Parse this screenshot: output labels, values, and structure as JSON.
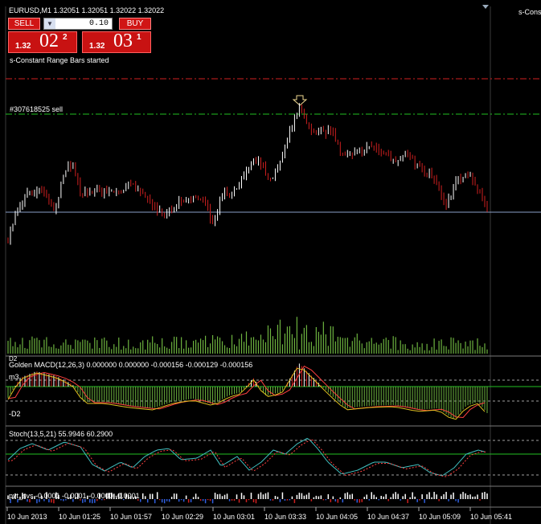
{
  "header": {
    "symbol_line": "EURUSD,M1  1.32051 1.32051 1.32022 1.32022",
    "right_label": "s-Cons"
  },
  "trade_panel": {
    "sell_label": "SELL",
    "buy_label": "BUY",
    "lot_value": "0.10",
    "sell_price": {
      "small": "1.32",
      "big": "02",
      "sup": "2"
    },
    "buy_price": {
      "small": "1.32",
      "big": "03",
      "sup": "1"
    }
  },
  "status_message": "s-Constant Range Bars started",
  "order_label": "#307618525 sell",
  "indicators": {
    "macd_title": "Golden MACD(12,26,3) 0.000000 0.000000 -0.000156 -0.000129 -0.000156",
    "macd_level_top": "m3",
    "macd_level_bottom": "-D2",
    "macd_small_label": "D2",
    "stoch_title": "Stoch(13,5,21) 55.9946 60.2900",
    "pvt_title": "pvt_svs -0.0001 -0.0001 -0.0000 -0.0001"
  },
  "time_axis": [
    "10 Jun 2013",
    "10 Jun 01:25",
    "10 Jun 01:57",
    "10 Jun 02:29",
    "10 Jun 03:01",
    "10 Jun 03:33",
    "10 Jun 04:05",
    "10 Jun 04:37",
    "10 Jun 05:09",
    "10 Jun 05:41"
  ],
  "colors": {
    "background": "#000000",
    "candle": "#ffffff",
    "candle_down": "#d02020",
    "volume": "#6db33f",
    "macd_hist_pos": "#ffffff",
    "macd_hist_neg": "#6db33f",
    "signal_line": "#ff4040",
    "sell_button": "#d01515",
    "stop_line": "#d02020",
    "order_line": "#22c022",
    "bid_line": "#8aa0c8"
  }
}
